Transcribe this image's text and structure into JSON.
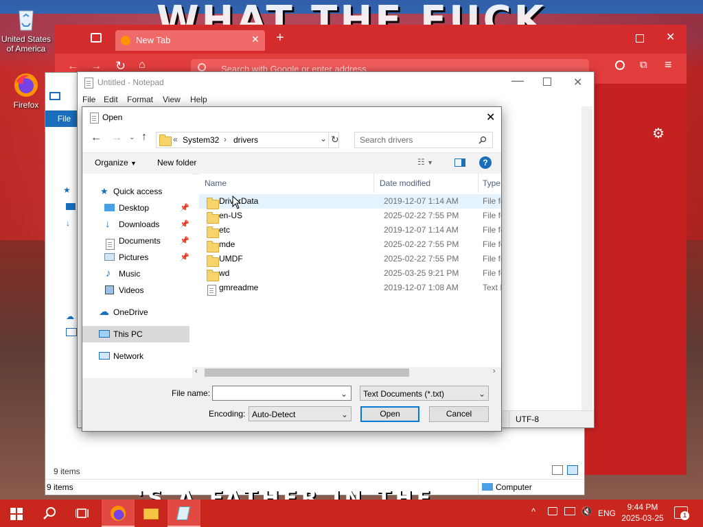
{
  "colors": {
    "accent": "#0078d7",
    "taskbar": "#c9261e",
    "firefox": "#e53434",
    "folder": "#f6d36b"
  },
  "wallpaper": {
    "headline": "WHAT THE FUCK",
    "footer": "'S A FATHER IN THE"
  },
  "desktop": [
    {
      "label": "United States of America",
      "icon": "recycle-bin-icon"
    },
    {
      "label": "Firefox",
      "icon": "firefox-icon"
    }
  ],
  "firefox": {
    "tab_title": "New Tab",
    "url_placeholder": "Search with Google or enter address"
  },
  "explorer": {
    "file_tab": "File",
    "status_items": "9 items",
    "status_items_inner": "9 items",
    "status_location": "Computer"
  },
  "notepad": {
    "title": "Untitled - Notepad",
    "menu": [
      "File",
      "Edit",
      "Format",
      "View",
      "Help"
    ],
    "encoding_status": "UTF-8"
  },
  "dialog": {
    "title": "Open",
    "breadcrumb_prefix": "«",
    "breadcrumb": [
      "System32",
      "drivers"
    ],
    "search_placeholder": "Search drivers",
    "organize": "Organize",
    "new_folder": "New folder",
    "nav": [
      {
        "label": "Quick access",
        "icon": "star-icon"
      },
      {
        "label": "Desktop",
        "icon": "desktop-icon",
        "pinned": true
      },
      {
        "label": "Downloads",
        "icon": "downloads-icon",
        "pinned": true
      },
      {
        "label": "Documents",
        "icon": "documents-icon",
        "pinned": true
      },
      {
        "label": "Pictures",
        "icon": "pictures-icon",
        "pinned": true
      },
      {
        "label": "Music",
        "icon": "music-icon"
      },
      {
        "label": "Videos",
        "icon": "videos-icon"
      },
      {
        "label": "OneDrive",
        "icon": "cloud-icon"
      },
      {
        "label": "This PC",
        "icon": "computer-icon",
        "selected": true
      },
      {
        "label": "Network",
        "icon": "network-icon"
      }
    ],
    "columns": [
      "Name",
      "Date modified",
      "Type"
    ],
    "files": [
      {
        "name": "DriverData",
        "date": "2019-12-07 1:14 AM",
        "type": "File fo",
        "kind": "folder"
      },
      {
        "name": "en-US",
        "date": "2025-02-22 7:55 PM",
        "type": "File fo",
        "kind": "folder"
      },
      {
        "name": "etc",
        "date": "2019-12-07 1:14 AM",
        "type": "File fo",
        "kind": "folder"
      },
      {
        "name": "mde",
        "date": "2025-02-22 7:55 PM",
        "type": "File fo",
        "kind": "folder"
      },
      {
        "name": "UMDF",
        "date": "2025-02-22 7:55 PM",
        "type": "File fo",
        "kind": "folder"
      },
      {
        "name": "wd",
        "date": "2025-03-25 9:21 PM",
        "type": "File fo",
        "kind": "folder"
      },
      {
        "name": "gmreadme",
        "date": "2019-12-07 1:08 AM",
        "type": "Text D",
        "kind": "text"
      }
    ],
    "file_name_label": "File name:",
    "file_name_value": "",
    "file_type_value": "Text Documents (*.txt)",
    "encoding_label": "Encoding:",
    "encoding_value": "Auto-Detect",
    "open_button": "Open",
    "cancel_button": "Cancel"
  },
  "taskbar": {
    "language": "ENG",
    "time": "9:44 PM",
    "date": "2025-03-25",
    "notification_count": "1"
  }
}
